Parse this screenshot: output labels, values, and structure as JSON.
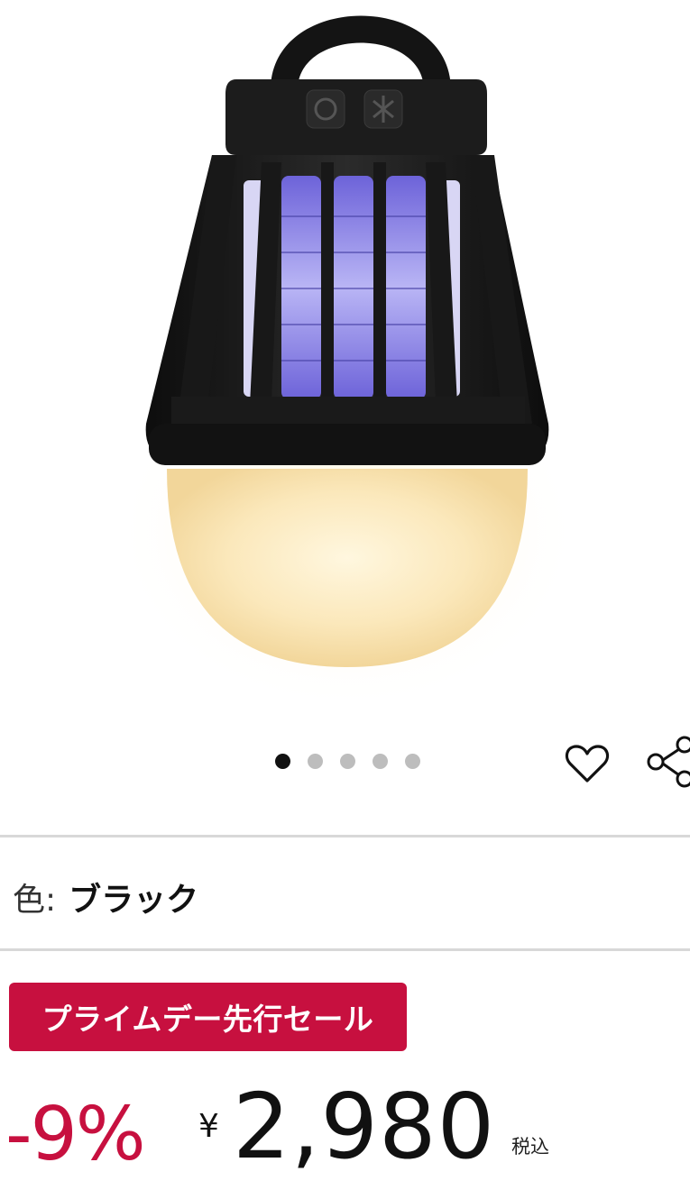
{
  "carousel": {
    "total": 5,
    "current": 1
  },
  "actions": {
    "wishlist_icon": "heart-outline-icon",
    "share_icon": "share-icon"
  },
  "variant": {
    "label": "色:",
    "value": "ブラック"
  },
  "badge": {
    "text": "プライムデー先行セール"
  },
  "pricing": {
    "discount": "-9%",
    "currency_symbol": "¥",
    "price": "2,980",
    "tax_note": "税込"
  },
  "colors": {
    "sale_accent": "#c7103f",
    "lamp_body": "#1e1e1e",
    "uv_light": "#7f77e6",
    "bulb_glow": "#fbe9bd"
  }
}
